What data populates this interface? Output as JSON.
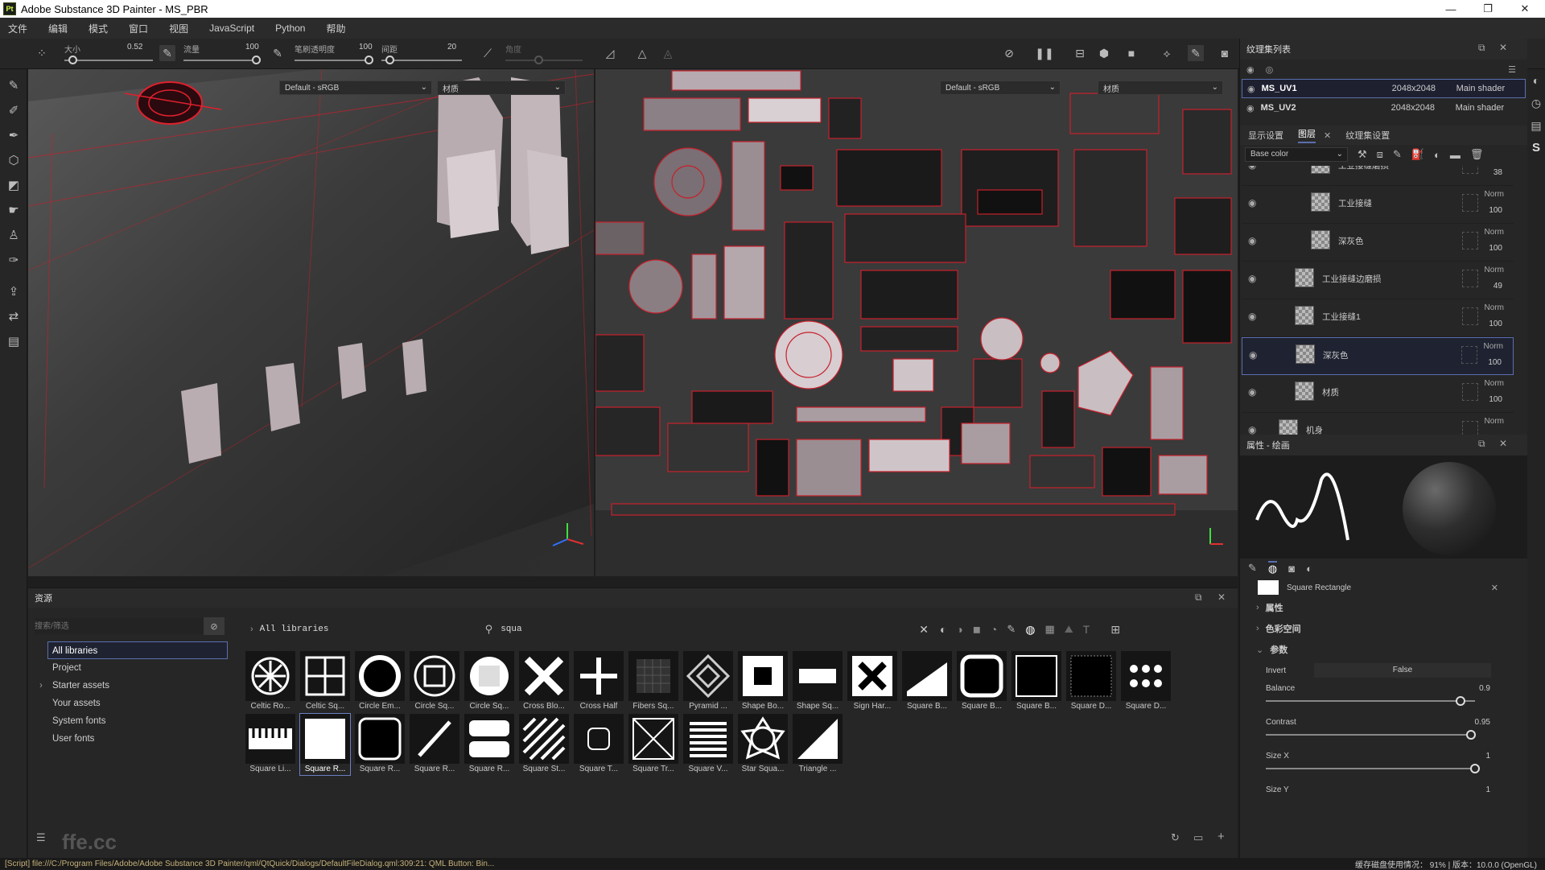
{
  "window": {
    "title": "Adobe Substance 3D Painter - MS_PBR",
    "logo": "Pt",
    "controls": {
      "minimize": "—",
      "maximize": "❐",
      "close": "✕"
    }
  },
  "menu": [
    "文件",
    "编辑",
    "模式",
    "窗口",
    "视图",
    "JavaScript",
    "Python",
    "帮助"
  ],
  "toolbar": {
    "size_label": "大小",
    "size_value": "0.52",
    "flow_label": "流量",
    "flow_value": "100",
    "opacity_label": "笔刷透明度",
    "opacity_value": "100",
    "spacing_label": "间距",
    "spacing_value": "20",
    "angle_label": "角度"
  },
  "view3d": {
    "channel": "Default - sRGB",
    "material": "材质"
  },
  "view2d": {
    "channel": "Default - sRGB",
    "material": "材质"
  },
  "texture_set": {
    "title": "纹理集列表",
    "items": [
      {
        "name": "MS_UV1",
        "size": "2048x2048",
        "shader": "Main shader"
      },
      {
        "name": "MS_UV2",
        "size": "2048x2048",
        "shader": "Main shader"
      }
    ]
  },
  "layers": {
    "tabs": [
      "显示设置",
      "图层",
      "纹理集设置"
    ],
    "channel": "Base color",
    "items": [
      {
        "name": "工业接缝磨损",
        "blend": "",
        "opacity": "38",
        "indent": 2
      },
      {
        "name": "工业接缝",
        "blend": "Norm",
        "opacity": "100",
        "indent": 2
      },
      {
        "name": "深灰色",
        "blend": "Norm",
        "opacity": "100",
        "indent": 2
      },
      {
        "name": "工业接缝边磨损",
        "blend": "Norm",
        "opacity": "49",
        "indent": 1
      },
      {
        "name": "工业接缝1",
        "blend": "Norm",
        "opacity": "100",
        "indent": 1
      },
      {
        "name": "深灰色",
        "blend": "Norm",
        "opacity": "100",
        "indent": 1
      },
      {
        "name": "材质",
        "blend": "Norm",
        "opacity": "100",
        "indent": 1
      },
      {
        "name": "机身",
        "blend": "Norm",
        "opacity": "",
        "indent": 0
      }
    ]
  },
  "properties": {
    "title": "属性 - 绘画",
    "brush_alpha": "Square Rectangle",
    "sections": [
      "属性",
      "色彩空间",
      "参数"
    ],
    "invert_label": "Invert",
    "invert_value": "False",
    "balance_label": "Balance",
    "balance_value": "0.9",
    "contrast_label": "Contrast",
    "contrast_value": "0.95",
    "sizex_label": "Size X",
    "sizex_value": "1",
    "sizey_label": "Size Y",
    "sizey_value": "1"
  },
  "assets": {
    "title": "资源",
    "filter_placeholder": "搜索/筛选",
    "breadcrumb": "All libraries",
    "search_value": "squa",
    "libraries": [
      "All libraries",
      "Project",
      "Starter assets",
      "Your assets",
      "System fonts",
      "User fonts"
    ],
    "tiles_row1": [
      "Celtic Ro...",
      "Celtic Sq...",
      "Circle Em...",
      "Circle Sq...",
      "Circle Sq...",
      "Cross Blo...",
      "Cross Half",
      "Fibers Sq...",
      "Pyramid ...",
      "Shape Bo...",
      "Shape Sq...",
      "Sign Har...",
      "Square B...",
      "Square B...",
      "Square B...",
      "Square D...",
      "Square D..."
    ],
    "tiles_row2": [
      "Square Li...",
      "Square R...",
      "Square R...",
      "Square R...",
      "Square R...",
      "Square St...",
      "Square T...",
      "Square Tr...",
      "Square V...",
      "Star Squa...",
      "Triangle ..."
    ]
  },
  "status": {
    "message": "[Script] file:///C:/Program Files/Adobe/Adobe Substance 3D Painter/qml/QtQuick/Dialogs/DefaultFileDialog.qml:309:21: QML Button: Bin...",
    "right": "缓存磁盘使用情况：  91%  |  版本：10.0.0 (OpenGL)"
  },
  "watermark": "ffe.cc",
  "colors": {
    "accent": "#5a6fae",
    "wire": "#c8202c",
    "panel": "#262626"
  }
}
